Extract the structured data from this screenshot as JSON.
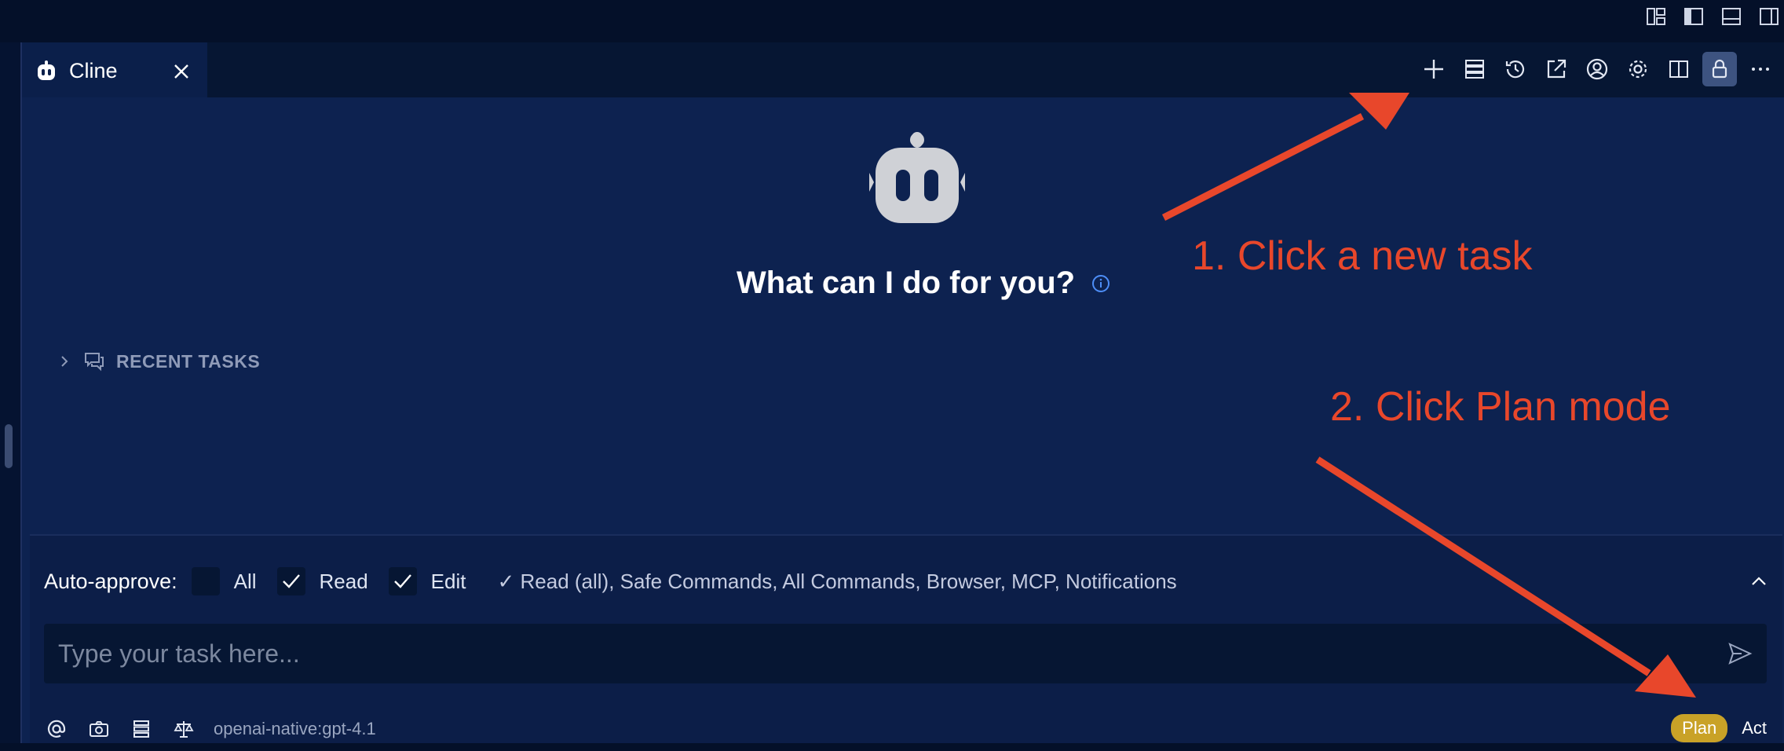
{
  "tab": {
    "title": "Cline"
  },
  "toolbar": {
    "buttons": [
      "plus-icon",
      "servers-icon",
      "history-icon",
      "popout-icon",
      "account-icon",
      "gear-icon",
      "split-icon",
      "lock-icon",
      "more-icon"
    ]
  },
  "welcome": {
    "headline": "What can I do for you?"
  },
  "recent_tasks": {
    "label": "RECENT TASKS"
  },
  "auto_approve": {
    "label": "Auto-approve:",
    "options": [
      {
        "label": "All",
        "checked": false
      },
      {
        "label": "Read",
        "checked": true
      },
      {
        "label": "Edit",
        "checked": true
      }
    ],
    "summary": "✓ Read (all), Safe Commands, All Commands, Browser, MCP, Notifications"
  },
  "input": {
    "placeholder": "Type your task here..."
  },
  "footer": {
    "model": "openai-native:gpt-4.1"
  },
  "mode": {
    "plan": "Plan",
    "act": "Act",
    "selected": "Plan"
  },
  "annotations": {
    "step1": "1. Click a new task",
    "step2": "2. Click Plan mode",
    "color": "#e8472b"
  },
  "colors": {
    "background": "#0d2250",
    "plan_badge": "#c9a227"
  }
}
